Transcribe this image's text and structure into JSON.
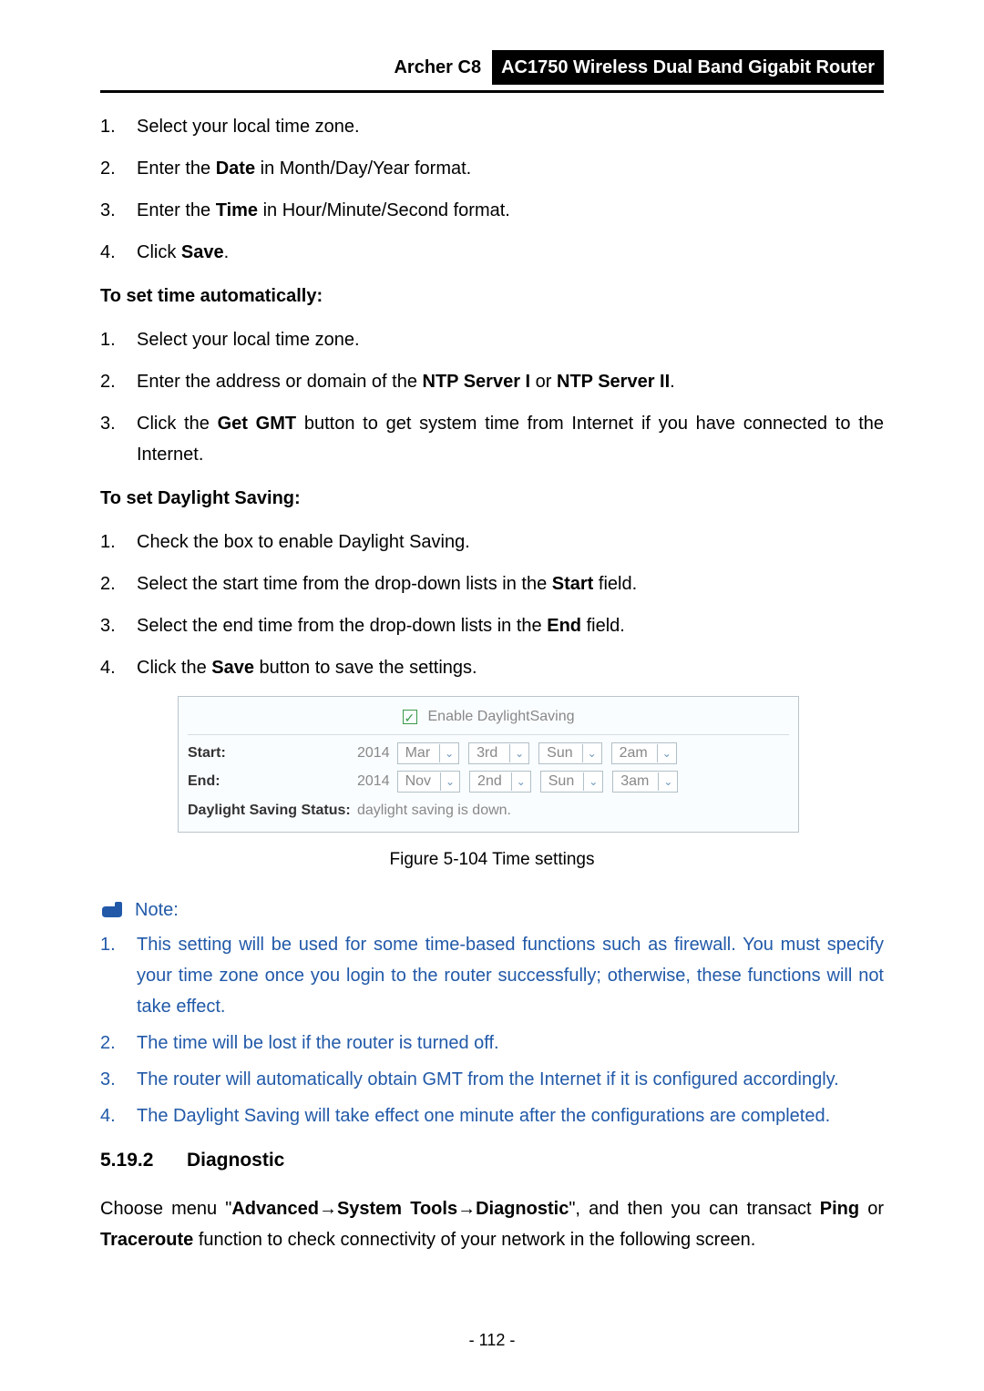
{
  "header": {
    "model": "Archer C8",
    "title": "AC1750 Wireless Dual Band Gigabit Router"
  },
  "list_manual": {
    "i1": "Select your local time zone.",
    "i2a": "Enter the ",
    "i2b": "Date",
    "i2c": " in Month/Day/Year format.",
    "i3a": "Enter the ",
    "i3b": "Time",
    "i3c": " in Hour/Minute/Second format.",
    "i4a": "Click ",
    "i4b": "Save",
    "i4c": "."
  },
  "heading_auto": "To set time automatically:",
  "list_auto": {
    "i1": "Select your local time zone.",
    "i2a": "Enter the address or domain of the ",
    "i2b": "NTP Server I",
    "i2c": " or ",
    "i2d": "NTP Server II",
    "i2e": ".",
    "i3a": "Click the ",
    "i3b": "Get GMT",
    "i3c": " button to get system time from Internet if you have connected to the Internet."
  },
  "heading_ds": "To set Daylight Saving:",
  "list_ds": {
    "i1": "Check the box to enable Daylight Saving.",
    "i2a": "Select the start time from the drop-down lists in the ",
    "i2b": "Start",
    "i2c": " field.",
    "i3a": "Select the end time from the drop-down lists in the ",
    "i3b": "End",
    "i3c": " field.",
    "i4a": "Click the ",
    "i4b": "Save",
    "i4c": " button to save the settings."
  },
  "shot": {
    "enable_label": "Enable DaylightSaving",
    "start_label": "Start:",
    "end_label": "End:",
    "status_label": "Daylight Saving Status:",
    "status_value": "daylight saving is down.",
    "start": {
      "year": "2014",
      "month": "Mar",
      "week": "3rd",
      "day": "Sun",
      "time": "2am"
    },
    "end": {
      "year": "2014",
      "month": "Nov",
      "week": "2nd",
      "day": "Sun",
      "time": "3am"
    }
  },
  "figure_caption": "Figure 5-104 Time settings",
  "note_label": "Note:",
  "notes": {
    "n1": "This setting will be used for some time-based functions such as firewall. You must specify your time zone once you login to the router successfully; otherwise, these functions will not take effect.",
    "n2": "The time will be lost if the router is turned off.",
    "n3": "The router will automatically obtain GMT from the Internet if it is configured accordingly.",
    "n4": "The Daylight Saving will take effect one minute after the configurations are completed."
  },
  "diag": {
    "num": "5.19.2",
    "title": "Diagnostic",
    "p1a": "Choose menu \"",
    "p1b": "Advanced",
    "arrow1": "→",
    "p1c": "System Tools",
    "arrow2": "→",
    "p1d": "Diagnostic",
    "p1e": "\", and then you can transact ",
    "p1f": "Ping",
    "p1g": " or ",
    "p1h": "Traceroute",
    "p1i": " function to check connectivity of your network in the following screen."
  },
  "page_number": "- 112 -"
}
